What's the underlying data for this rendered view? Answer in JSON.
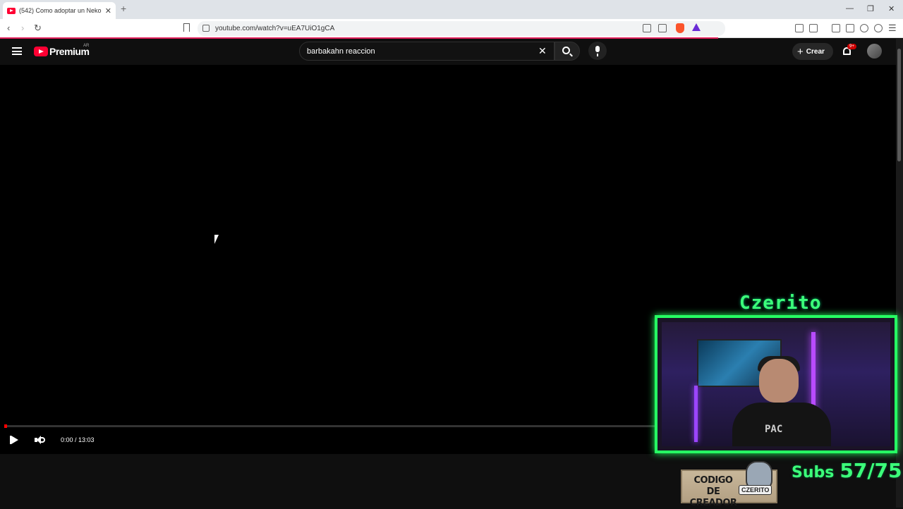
{
  "browser": {
    "tab_title": "(542) Como adoptar un Neko c",
    "tab_close": "✕",
    "new_tab": "+",
    "url": "youtube.com/watch?v=uEA7UiO1gCA",
    "window_controls": [
      "—",
      "❐",
      "✕"
    ]
  },
  "youtube": {
    "brand": "Premium",
    "country": "AR",
    "search_value": "barbakahn reaccion",
    "search_clear": "✕",
    "create_label": "Crear",
    "notifications_badge": "9+"
  },
  "player": {
    "time": "0:00 / 13:03",
    "progress_fraction": 0.0
  },
  "overlay": {
    "streamer_name": "Czerito",
    "codigo_line1": "CODIGO",
    "codigo_line2": "DE CREADOR",
    "codigo_tag": "CZERITO",
    "shirt_text": "PAC",
    "subs_label": "Subs",
    "subs_value": "57/75",
    "accent_color": "#26ff63"
  }
}
